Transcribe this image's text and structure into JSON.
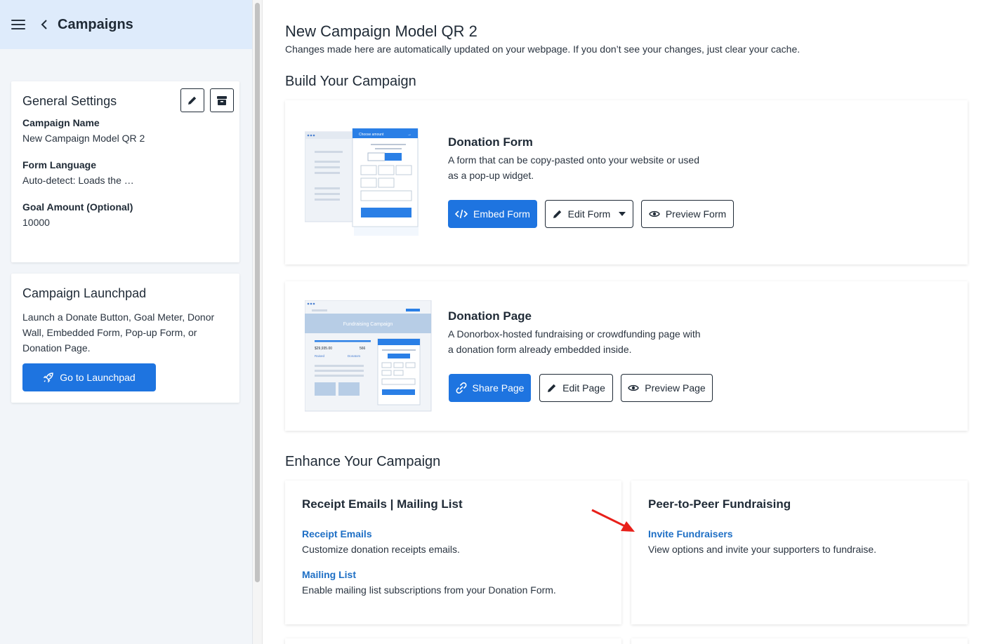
{
  "sidebar": {
    "title": "Campaigns",
    "general": {
      "title": "General Settings",
      "fields": [
        {
          "label": "Campaign Name",
          "value": "New Campaign Model QR 2"
        },
        {
          "label": "Form Language",
          "value": "Auto-detect: Loads the …"
        },
        {
          "label": "Goal Amount (Optional)",
          "value": "10000"
        }
      ]
    },
    "launchpad": {
      "title": "Campaign Launchpad",
      "description": "Launch a Donate Button, Goal Meter, Donor Wall, Embedded Form, Pop-up Form, or Donation Page.",
      "button": "Go to Launchpad"
    }
  },
  "main": {
    "title": "New Campaign Model QR 2",
    "subtitle": "Changes made here are automatically updated on your webpage. If you don’t see your changes, just clear your cache.",
    "build_title": "Build Your Campaign",
    "donation_form": {
      "title": "Donation Form",
      "description": "A form that can be copy-pasted onto your website or used as a pop-up widget.",
      "embed_button": "Embed Form",
      "edit_button": "Edit Form",
      "preview_button": "Preview Form",
      "illustration": {
        "header": "Choose amount"
      }
    },
    "donation_page": {
      "title": "Donation Page",
      "description": "A Donorbox-hosted fundraising or crowdfunding page with a donation form already embedded inside.",
      "share_button": "Share Page",
      "edit_button": "Edit Page",
      "preview_button": "Preview Page",
      "illustration": {
        "banner": "Fundraising Campaign",
        "raised_amount": "$29,935.00",
        "raised_label": "Raised",
        "donors_count": "566",
        "donors_label": "Donators"
      }
    },
    "enhance_title": "Enhance Your Campaign",
    "receipt_card": {
      "title": "Receipt Emails | Mailing List",
      "items": [
        {
          "link": "Receipt Emails",
          "description": "Customize donation receipts emails."
        },
        {
          "link": "Mailing List",
          "description": "Enable mailing list subscriptions from your Donation Form."
        }
      ]
    },
    "p2p_card": {
      "title": "Peer-to-Peer Fundraising",
      "items": [
        {
          "link": "Invite Fundraisers",
          "description": "View options and invite your supporters to fundraise."
        }
      ]
    }
  },
  "colors": {
    "primary": "#1e74e0",
    "link": "#1e6fc5",
    "sidebar_header": "#deebfb",
    "sidebar_bg": "#f2f5f9",
    "annotation_arrow": "#e8201a"
  },
  "icons": [
    "hamburger-icon",
    "chevron-left-icon",
    "pencil-icon",
    "archive-icon",
    "rocket-icon",
    "code-icon",
    "caret-down-icon",
    "eye-icon",
    "link-icon",
    "arrow-annotation-icon"
  ]
}
